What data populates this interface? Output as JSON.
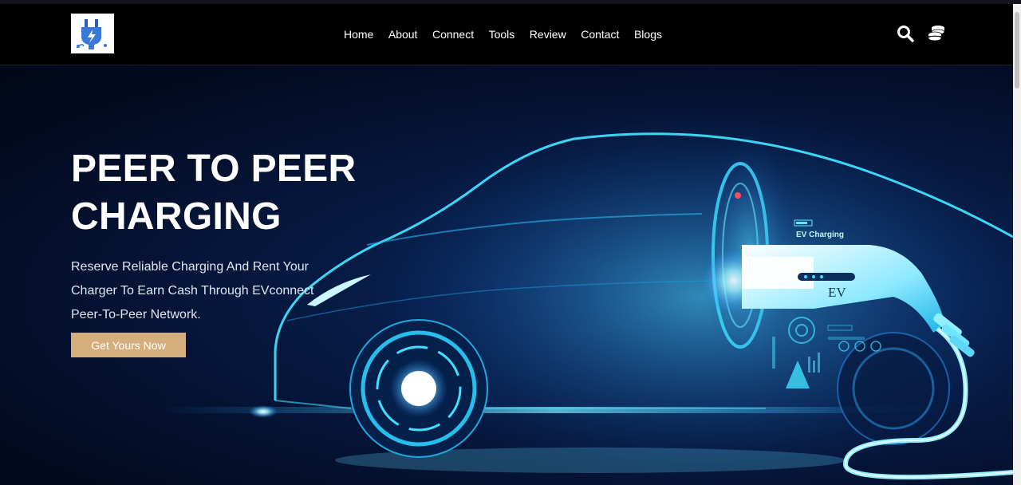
{
  "nav": {
    "logo_icon": "ev-plug-logo-icon",
    "items": [
      {
        "label": "Home"
      },
      {
        "label": "About"
      },
      {
        "label": "Connect"
      },
      {
        "label": "Tools"
      },
      {
        "label": "Review"
      },
      {
        "label": "Contact"
      },
      {
        "label": "Blogs"
      }
    ],
    "icons": [
      "search-icon",
      "coins-icon"
    ]
  },
  "hero": {
    "title": "PEER TO PEER CHARGING",
    "subtitle": "Reserve Reliable Charging And Rent Your Charger To Earn Cash Through EVconnect Peer-To-Peer Network.",
    "cta_label": "Get Yours Now",
    "image_text": {
      "charging_label": "EV Charging",
      "plug_label": "EV"
    }
  },
  "colors": {
    "nav_bg": "#000000",
    "cta_bg": "#d5ae7e",
    "hero_glow": "#3fe0ff",
    "hero_bg": "#06183e"
  }
}
